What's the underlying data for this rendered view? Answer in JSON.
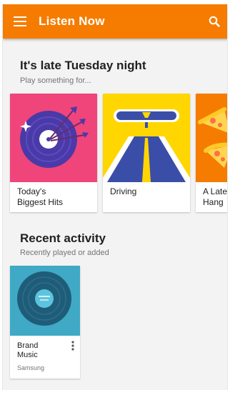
{
  "appbar": {
    "title": "Listen Now",
    "menu_icon": "hamburger-menu-icon",
    "search_icon": "search-icon",
    "color": "#f57c00"
  },
  "section1": {
    "title": "It's late Tuesday night",
    "subtitle": "Play something for..."
  },
  "playlists": [
    {
      "label_line1": "Today's",
      "label_line2": "Biggest Hits",
      "color": "#f0457a"
    },
    {
      "label_line1": "Driving",
      "label_line2": "",
      "color": "#ffd600"
    },
    {
      "label_line1": "A Late",
      "label_line2": "Hang",
      "color": "#f57c00"
    }
  ],
  "section2": {
    "title": "Recent activity",
    "subtitle": "Recently played or added"
  },
  "recent": {
    "name_line1": "Brand",
    "name_line2": "Music",
    "artist": "Samsung",
    "more_icon": "more-vertical-icon",
    "color": "#3fa9c6"
  }
}
